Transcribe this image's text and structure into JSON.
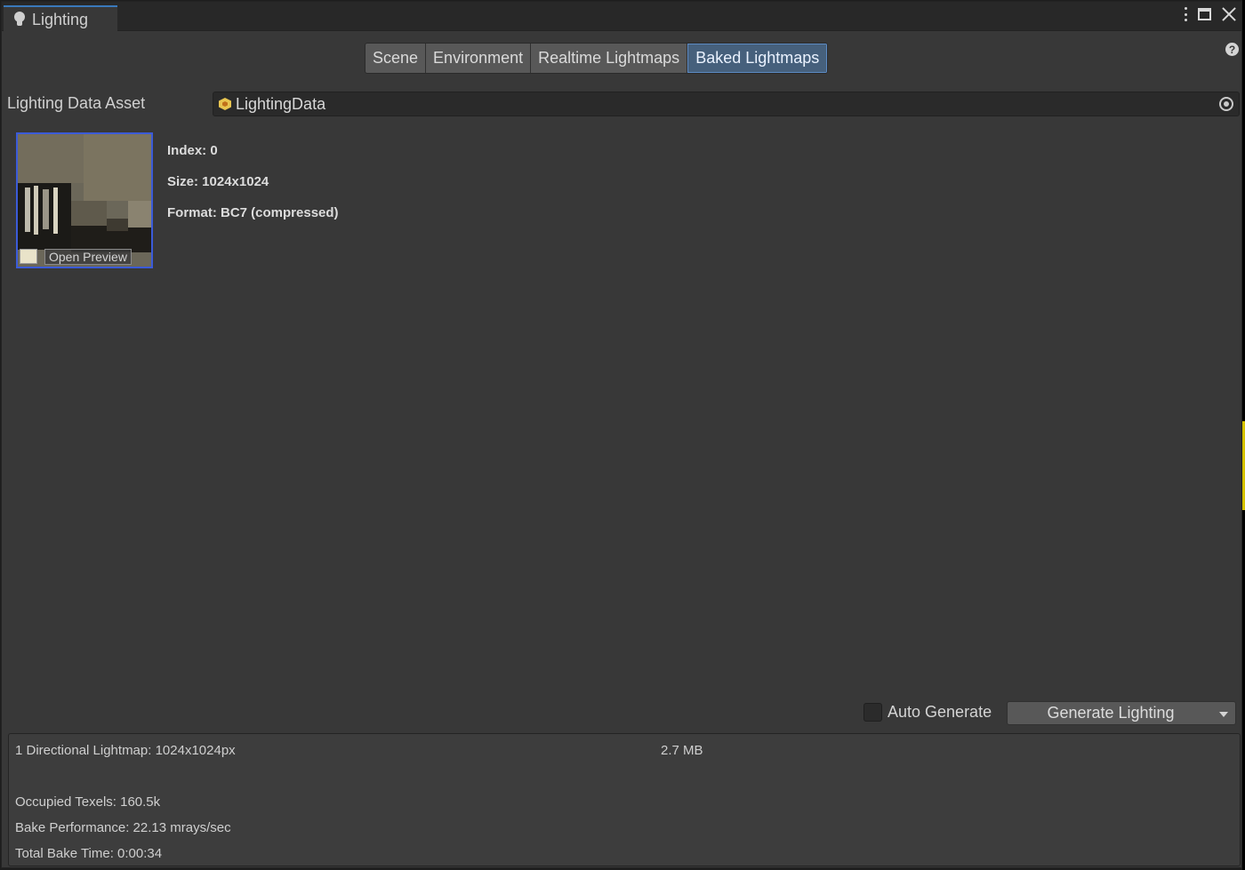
{
  "window": {
    "title": "Lighting"
  },
  "tabs": [
    {
      "label": "Scene",
      "active": false
    },
    {
      "label": "Environment",
      "active": false
    },
    {
      "label": "Realtime Lightmaps",
      "active": false
    },
    {
      "label": "Baked Lightmaps",
      "active": true
    }
  ],
  "help_icon": "?",
  "asset": {
    "label": "Lighting Data Asset",
    "value": "LightingData"
  },
  "lightmap": {
    "open_preview": "Open Preview",
    "index": "Index: 0",
    "size": "Size: 1024x1024",
    "format": "Format: BC7 (compressed)"
  },
  "controls": {
    "auto_generate_label": "Auto Generate",
    "auto_generate_checked": false,
    "generate_label": "Generate Lighting"
  },
  "stats": {
    "lightmaps": "1 Directional Lightmap: 1024x1024px",
    "memory": "2.7 MB",
    "occupied_texels": "Occupied Texels: 160.5k",
    "bake_performance": "Bake Performance: 22.13 mrays/sec",
    "total_bake_time": "Total Bake Time: 0:00:34"
  },
  "colors": {
    "accent": "#3b5bd8",
    "active_tab": "#46607c",
    "panel": "#383838"
  }
}
